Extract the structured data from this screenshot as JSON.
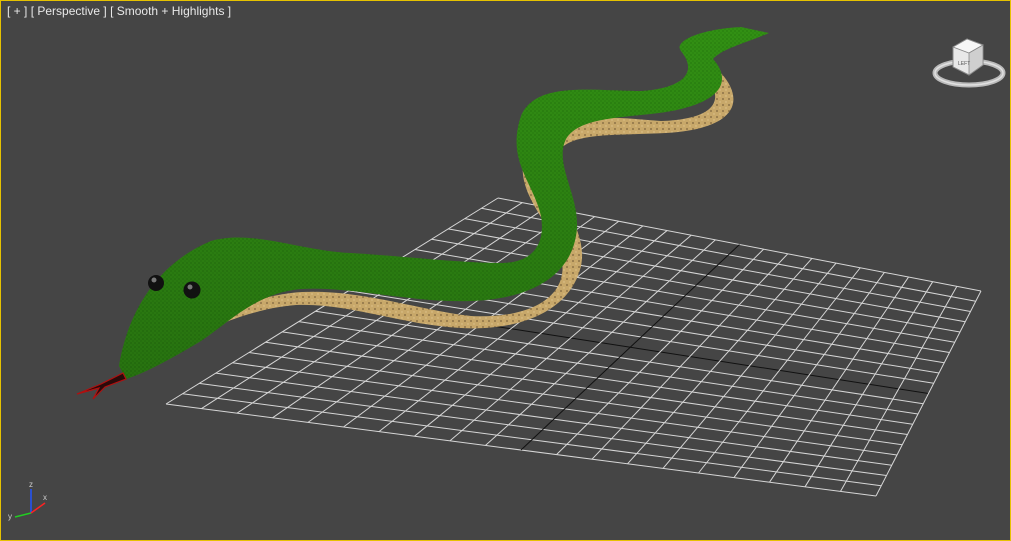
{
  "viewport": {
    "menu_label": "[ + ]",
    "view_label": "[ Perspective ]",
    "shading_label": "[ Smooth + Highlights ]",
    "border_color": "#e6c200",
    "background_color": "#454545"
  },
  "scene": {
    "object": "snake",
    "body_color": "#2e8a12",
    "belly_color": "#c8a86a",
    "tongue_color": "#b01010",
    "eye_color": "#111111",
    "grid_color": "#d6d6d6",
    "grid_axis_color": "#111111"
  },
  "viewcube": {
    "face_label": "LEFT"
  },
  "axis_tripod": {
    "x_label": "x",
    "y_label": "y",
    "z_label": "z"
  }
}
